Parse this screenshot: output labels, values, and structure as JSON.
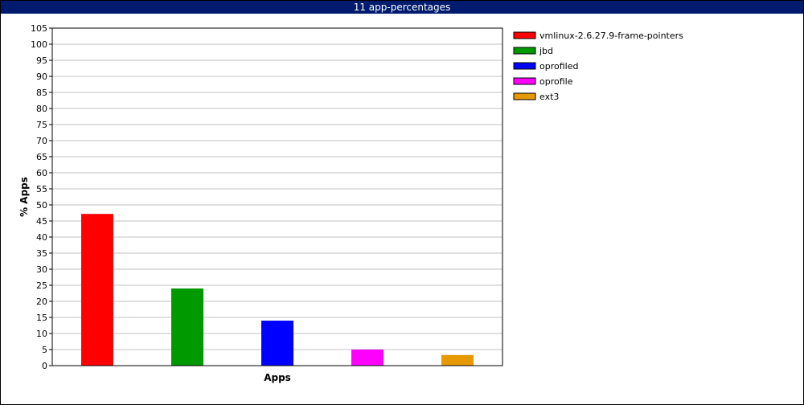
{
  "window": {
    "title": "11 app-percentages"
  },
  "chart_data": {
    "type": "bar",
    "title": "11 app-percentages",
    "xlabel": "Apps",
    "ylabel": "% Apps",
    "ylim": [
      0,
      105
    ],
    "ytick_step": 5,
    "grid": true,
    "legend_placement": "right",
    "series": [
      {
        "name": "vmlinux-2.6.27.9-frame-pointers",
        "value": 47.2,
        "color": "#ff0000"
      },
      {
        "name": "jbd",
        "value": 24.0,
        "color": "#009900"
      },
      {
        "name": "oprofiled",
        "value": 14.0,
        "color": "#0000ff"
      },
      {
        "name": "oprofile",
        "value": 5.0,
        "color": "#ff00ff"
      },
      {
        "name": "ext3",
        "value": 3.3,
        "color": "#e69900"
      }
    ]
  }
}
